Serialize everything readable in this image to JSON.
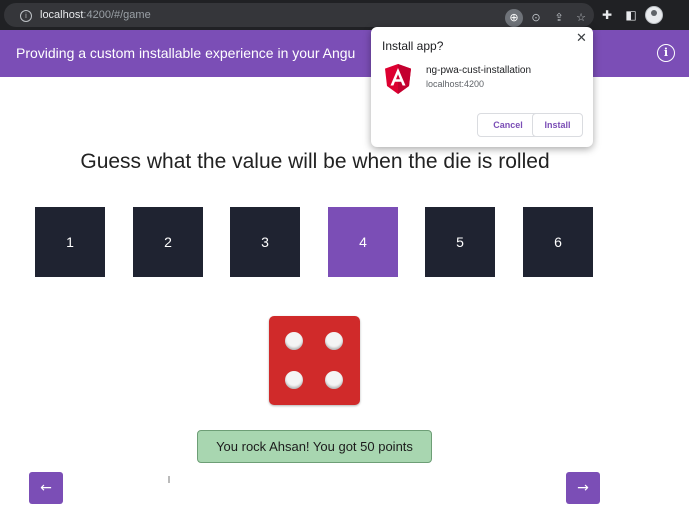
{
  "browser": {
    "url_host": "localhost",
    "url_path": ":4200/#/game",
    "toolbar_icons": [
      "install-app-icon",
      "zoom-icon",
      "share-icon",
      "bookmark-star-icon",
      "extensions-icon",
      "sidebar-icon",
      "profile-avatar"
    ]
  },
  "header": {
    "title": "Providing a custom installable experience in your Angu"
  },
  "install_popup": {
    "title": "Install app?",
    "app_name": "ng-pwa-cust-installation",
    "origin": "localhost:4200",
    "cancel_label": "Cancel",
    "install_label": "Install"
  },
  "game": {
    "heading": "Guess what the value will be when the die is rolled",
    "choices": [
      "1",
      "2",
      "3",
      "4",
      "5",
      "6"
    ],
    "selected_choice": "4",
    "die_value": 4,
    "result_message": "You rock Ahsan! You got 50 points"
  },
  "colors": {
    "brand_purple": "#7b4eb6",
    "tile_dark": "#1f2331",
    "die_red": "#d02a2a",
    "success_bg": "#a8d6b0"
  }
}
